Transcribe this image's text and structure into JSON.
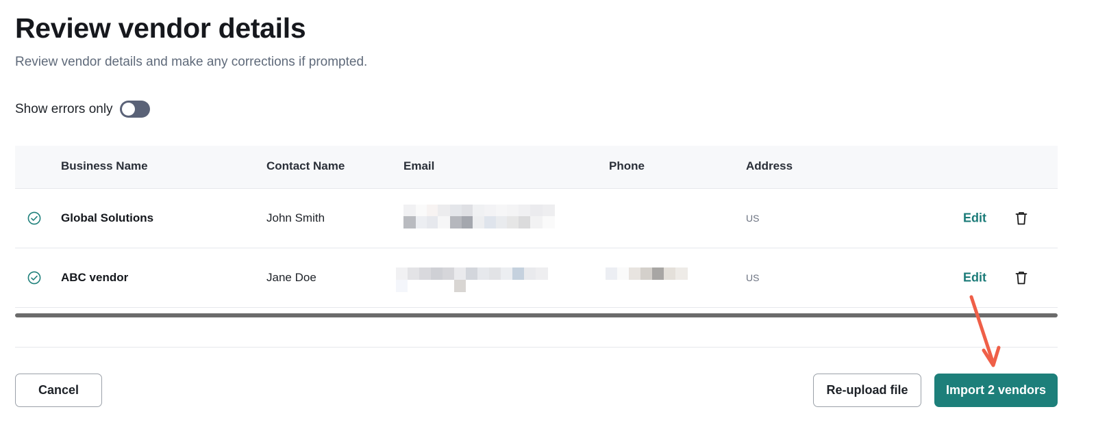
{
  "header": {
    "title": "Review vendor details",
    "subtitle": "Review vendor details and make any corrections if prompted."
  },
  "filter": {
    "label": "Show errors only",
    "enabled": false
  },
  "table": {
    "columns": [
      "Business Name",
      "Contact Name",
      "Email",
      "Phone",
      "Address"
    ],
    "rows": [
      {
        "status": "valid",
        "business_name": "Global Solutions",
        "contact_name": "John Smith",
        "address": "US",
        "edit_label": "Edit"
      },
      {
        "status": "valid",
        "business_name": "ABC vendor",
        "contact_name": "Jane Doe",
        "address": "US",
        "edit_label": "Edit"
      }
    ]
  },
  "footer": {
    "cancel_label": "Cancel",
    "reupload_label": "Re-upload file",
    "import_label": "Import 2 vendors"
  },
  "colors": {
    "accent": "#1d7f7a",
    "annotation_arrow": "#ef5f48"
  }
}
